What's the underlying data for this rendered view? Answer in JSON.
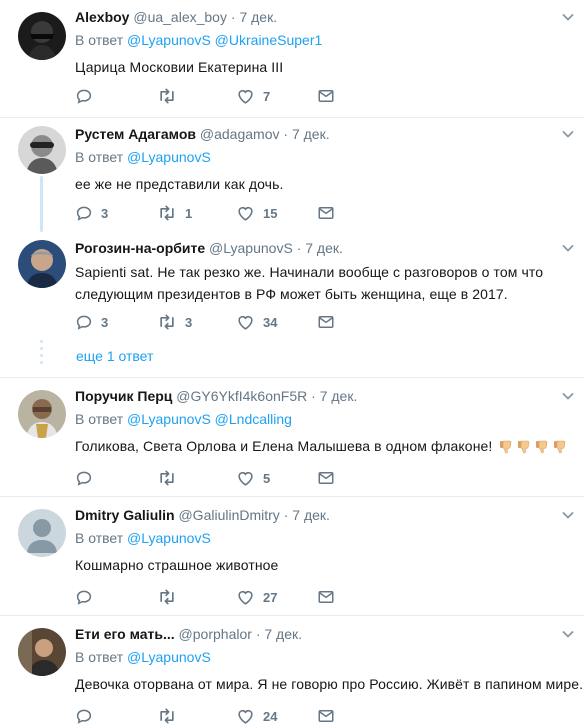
{
  "reply_prefix": "В ответ",
  "dot": "·",
  "icons": {
    "reply": "reply-icon",
    "retweet": "retweet-icon",
    "like": "like-icon",
    "dm": "direct-message-icon",
    "menu": "chevron-down-icon"
  },
  "colors": {
    "link": "#1da1f2",
    "muted": "#657786",
    "thread_line": "#cfe6f8"
  },
  "tweets": [
    {
      "name": "Alexboy",
      "handle": "@ua_alex_boy",
      "time": "7 дек.",
      "mentions": [
        "@LyapunovS",
        "@UkraineSuper1"
      ],
      "text": "Царица Московии Екатерина III",
      "replies": "",
      "retweets": "",
      "likes": "7"
    },
    {
      "name": "Рустем Адагамов",
      "handle": "@adagamov",
      "time": "7 дек.",
      "mentions": [
        "@LyapunovS"
      ],
      "text": "ее же не представили как дочь.",
      "replies": "3",
      "retweets": "1",
      "likes": "15"
    },
    {
      "name": "Рогозин-на-орбите",
      "handle": "@LyapunovS",
      "time": "7 дек.",
      "mentions": [],
      "text_line1": "Sapienti sat. Не так резко же. Начинали вообще с разговоров о том что",
      "text_line2": "следующим президентов в РФ может быть женщина, еще в 2017.",
      "replies": "3",
      "retweets": "3",
      "likes": "34"
    },
    {
      "name": "Поручик Перц",
      "handle": "@GY6YkfI4k6onF5R",
      "time": "7 дек.",
      "mentions": [
        "@LyapunovS",
        "@Lndcalling"
      ],
      "text": "Голикова, Света Орлова и Елена Малышева в одном флаконе!",
      "emoji": "thumbs-down-emoji x4",
      "replies": "",
      "retweets": "",
      "likes": "5"
    },
    {
      "name": "Dmitry Galiulin",
      "handle": "@GaliulinDmitry",
      "time": "7 дек.",
      "mentions": [
        "@LyapunovS"
      ],
      "text": "Кошмарно страшное животное",
      "replies": "",
      "retweets": "",
      "likes": "27"
    },
    {
      "name": "Ети его мать...",
      "handle": "@porphalor",
      "time": "7 дек.",
      "mentions": [
        "@LyapunovS"
      ],
      "text": "Девочка оторвана от мира. Я не говорю про Россию. Живёт в папином мире.",
      "replies": "",
      "retweets": "",
      "likes": "24"
    }
  ],
  "more_replies": "еще 1 ответ"
}
